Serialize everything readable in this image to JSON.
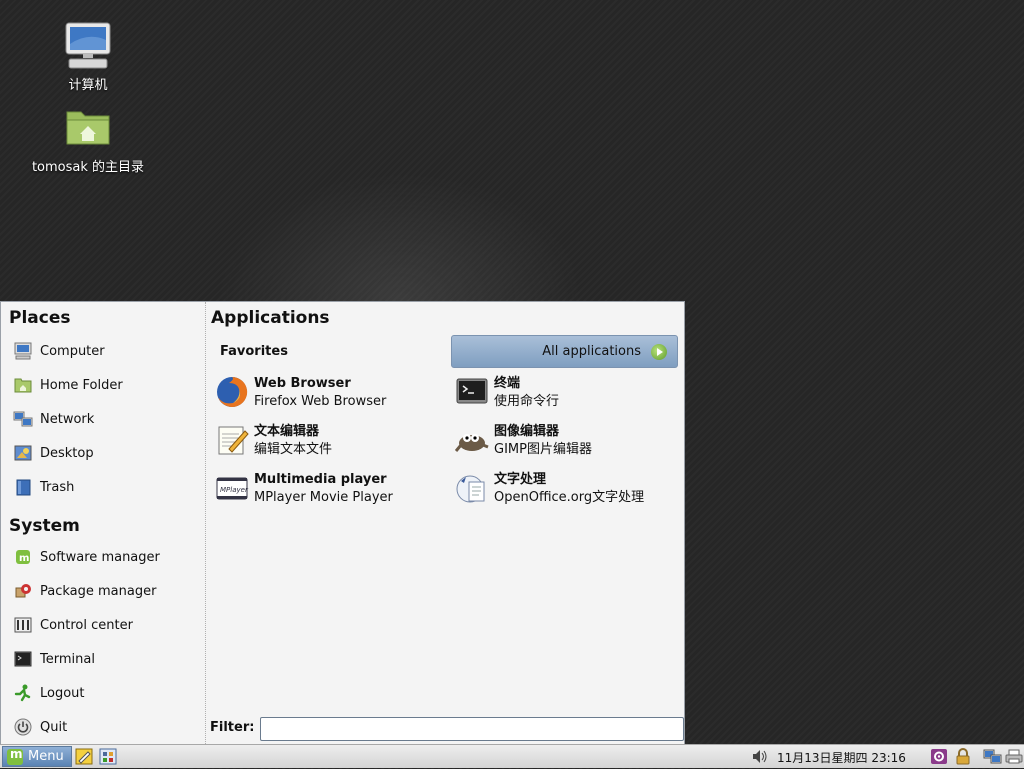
{
  "desktop": {
    "icons": [
      {
        "label": "计算机",
        "icon": "computer-icon"
      },
      {
        "label": "tomosak 的主目录",
        "icon": "home-folder-icon"
      }
    ]
  },
  "menu": {
    "places_title": "Places",
    "places": [
      {
        "label": "Computer",
        "icon": "computer-icon"
      },
      {
        "label": "Home Folder",
        "icon": "home-folder-icon"
      },
      {
        "label": "Network",
        "icon": "network-icon"
      },
      {
        "label": "Desktop",
        "icon": "desktop-icon"
      },
      {
        "label": "Trash",
        "icon": "trash-icon"
      }
    ],
    "system_title": "System",
    "system": [
      {
        "label": "Software manager",
        "icon": "software-manager-icon"
      },
      {
        "label": "Package manager",
        "icon": "package-manager-icon"
      },
      {
        "label": "Control center",
        "icon": "control-center-icon"
      },
      {
        "label": "Terminal",
        "icon": "terminal-icon"
      },
      {
        "label": "Logout",
        "icon": "logout-icon"
      },
      {
        "label": "Quit",
        "icon": "power-icon"
      }
    ],
    "applications_title": "Applications",
    "favorites_title": "Favorites",
    "all_applications_label": "All applications",
    "favorites": [
      {
        "name": "Web Browser",
        "desc": "Firefox Web Browser",
        "icon": "firefox-icon"
      },
      {
        "name": "终端",
        "desc": "使用命令行",
        "icon": "terminal-icon"
      },
      {
        "name": "文本编辑器",
        "desc": "编辑文本文件",
        "icon": "text-editor-icon"
      },
      {
        "name": "图像编辑器",
        "desc": "GIMP图片编辑器",
        "icon": "gimp-icon"
      },
      {
        "name": "Multimedia player",
        "desc": "MPlayer Movie Player",
        "icon": "mplayer-icon"
      },
      {
        "name": "文字处理",
        "desc": "OpenOffice.org文字处理",
        "icon": "writer-icon"
      }
    ],
    "filter_label": "Filter:",
    "filter_value": ""
  },
  "taskbar": {
    "menu_label": "Menu",
    "clock": "11月13日星期四 23:16"
  }
}
